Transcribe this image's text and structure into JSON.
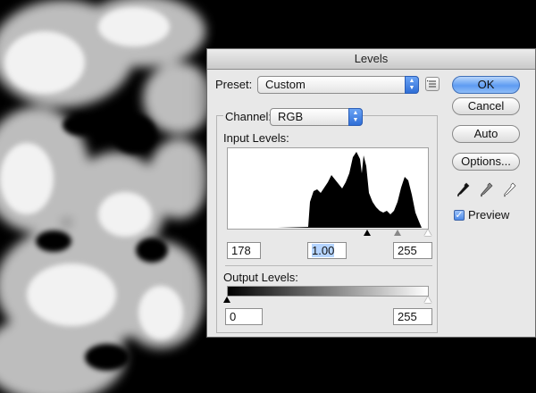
{
  "dialog": {
    "title": "Levels"
  },
  "preset": {
    "label": "Preset:",
    "value": "Custom"
  },
  "channel": {
    "label": "Channel:",
    "value": "RGB"
  },
  "input_levels": {
    "label": "Input Levels:",
    "black": "178",
    "gamma": "1.00",
    "white": "255"
  },
  "output_levels": {
    "label": "Output Levels:",
    "black": "0",
    "white": "255"
  },
  "buttons": {
    "ok": "OK",
    "cancel": "Cancel",
    "auto": "Auto",
    "options": "Options..."
  },
  "preview": {
    "label": "Preview",
    "checked": true
  },
  "icons": [
    "preset-options-icon",
    "black-eyedropper-icon",
    "gray-eyedropper-icon",
    "white-eyedropper-icon"
  ]
}
